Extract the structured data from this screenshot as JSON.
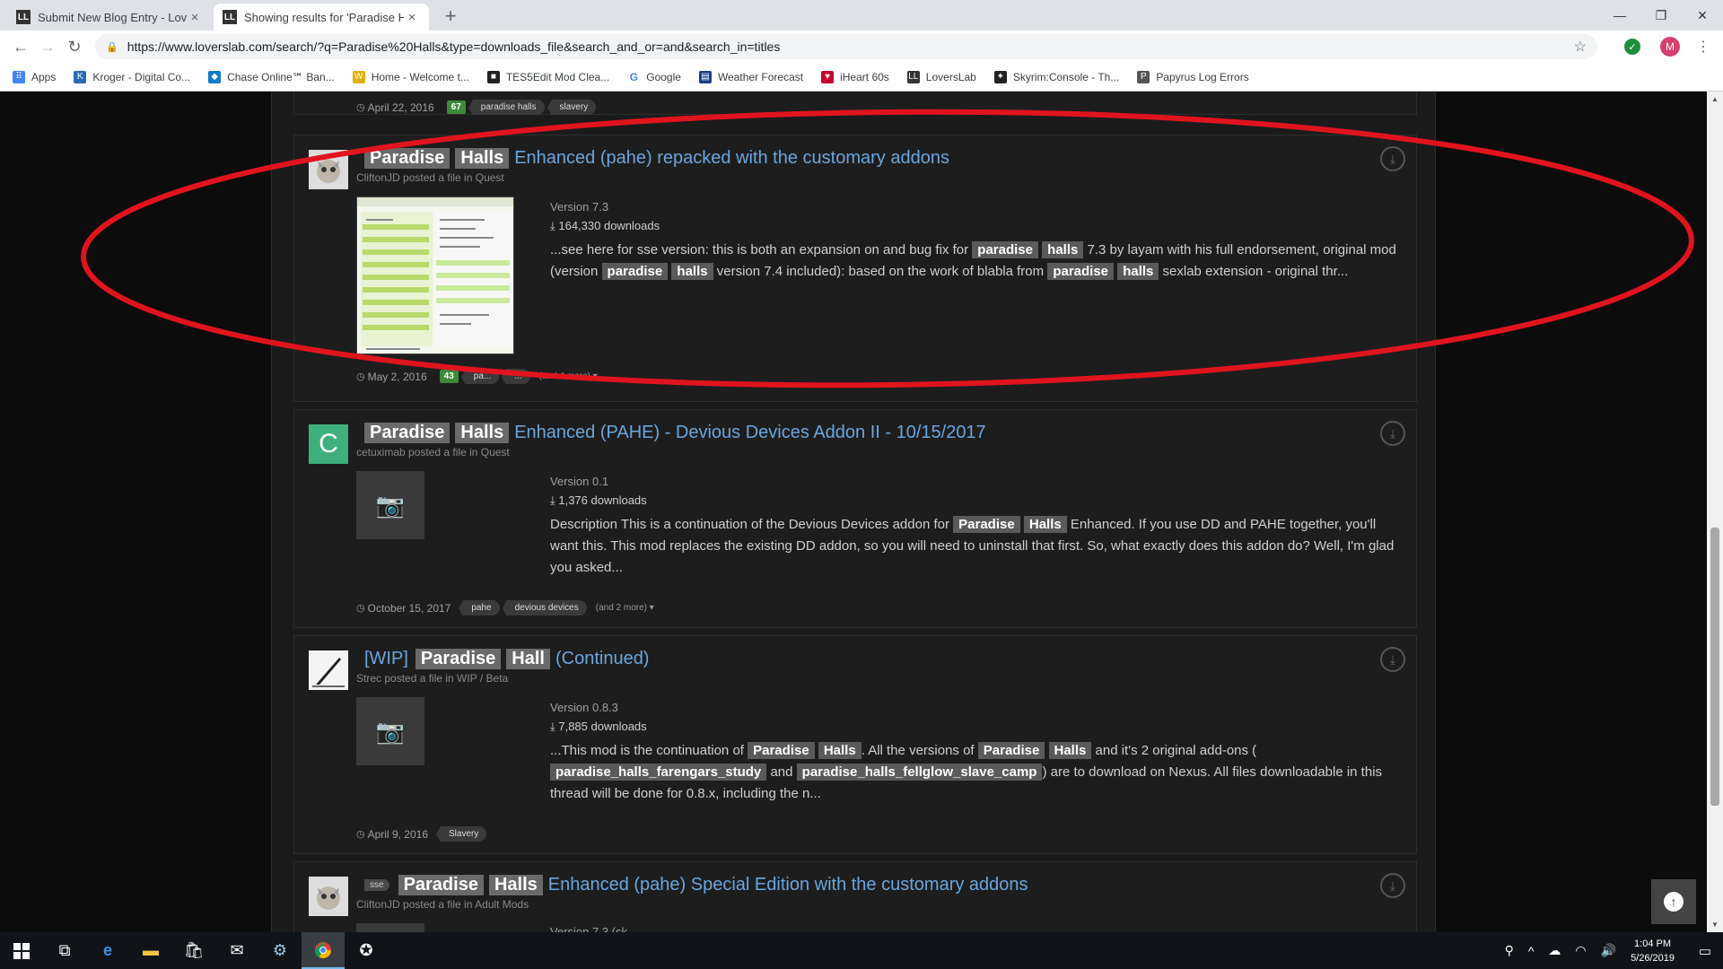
{
  "browser": {
    "tabs": [
      {
        "label": "Submit New Blog Entry - LoversL..."
      },
      {
        "label": "Showing results for 'Paradise Hal..."
      }
    ],
    "url": "https://www.loverslab.com/search/?q=Paradise%20Halls&type=downloads_file&search_and_or=and&search_in=titles",
    "profile_initial": "M",
    "bookmarks": [
      {
        "label": "Apps",
        "color": "#4285f4"
      },
      {
        "label": "Kroger - Digital Co...",
        "color": "#2a6ab8"
      },
      {
        "label": "Chase Online℠ Ban...",
        "color": "#117aca"
      },
      {
        "label": "Home - Welcome t...",
        "color": "#e0b000"
      },
      {
        "label": "TES5Edit Mod Clea...",
        "color": "#222222"
      },
      {
        "label": "Google",
        "color": "#4285f4"
      },
      {
        "label": "Weather Forecast",
        "color": "#1b3f8b"
      },
      {
        "label": "iHeart 60s",
        "color": "#c6002b"
      },
      {
        "label": "LoversLab",
        "color": "#333333"
      },
      {
        "label": "Skyrim:Console - Th...",
        "color": "#222222"
      },
      {
        "label": "Papyrus Log Errors",
        "color": "#555555"
      }
    ]
  },
  "results": {
    "top": {
      "date": "April 22, 2016",
      "count": "67",
      "tags": [
        "paradise halls",
        "slavery"
      ]
    },
    "r1": {
      "title_kw1": "Paradise",
      "title_kw2": "Halls",
      "title_rest": "Enhanced (pahe) repacked with the customary addons",
      "byline": "CliftonJD posted a file in Quest",
      "version": "Version 7.3",
      "downloads": "164,330 downloads",
      "snippet": [
        {
          "t": "...see here for sse version: this is both an expansion on and bug fix for "
        },
        {
          "k": "paradise"
        },
        {
          "t": " "
        },
        {
          "k": "halls"
        },
        {
          "t": " 7.3 by layam with his full endorsement, original mod (version "
        },
        {
          "k": "paradise"
        },
        {
          "t": " "
        },
        {
          "k": "halls"
        },
        {
          "t": " version 7.4 included): based on the work of blabla from "
        },
        {
          "k": "paradise"
        },
        {
          "t": " "
        },
        {
          "k": "halls"
        },
        {
          "t": " sexlab extension - original thr..."
        }
      ],
      "date": "May 2, 2016",
      "count": "43",
      "tags": [
        "pa...",
        "..."
      ],
      "more": "(and 4 more) ▾"
    },
    "r2": {
      "avatar_letter": "C",
      "title_kw1": "Paradise",
      "title_kw2": "Halls",
      "title_rest": "Enhanced (PAHE) - Devious Devices Addon II - 10/15/2017",
      "byline": "cetuximab posted a file in Quest",
      "version": "Version 0.1",
      "downloads": "1,376 downloads",
      "snippet": [
        {
          "t": "Description This is a continuation of the Devious Devices addon for "
        },
        {
          "k": "Paradise"
        },
        {
          "t": " "
        },
        {
          "k": "Halls"
        },
        {
          "t": " Enhanced. If you use DD and PAHE together, you'll want this. This mod replaces the existing DD addon, so you will need to uninstall that first. So, what exactly does this addon do? Well, I'm glad you asked..."
        }
      ],
      "date": "October 15, 2017",
      "tags": [
        "pahe",
        "devious devices"
      ],
      "more": "(and 2 more) ▾"
    },
    "r3": {
      "title_pre": "[WIP]",
      "title_kw1": "Paradise",
      "title_kw2": "Hall",
      "title_rest": "(Continued)",
      "byline": "Strec posted a file in WIP / Beta",
      "version": "Version 0.8.3",
      "downloads": "7,885 downloads",
      "snippet": [
        {
          "t": "...This mod is the continuation of "
        },
        {
          "k": "Paradise"
        },
        {
          "t": " "
        },
        {
          "k": "Halls"
        },
        {
          "t": ". All the versions of "
        },
        {
          "k": "Paradise"
        },
        {
          "t": " "
        },
        {
          "k": "Halls"
        },
        {
          "t": " and it's 2 original add-ons ( "
        },
        {
          "k": "paradise_halls_farengars_study"
        },
        {
          "t": " and "
        },
        {
          "k": "paradise_halls_fellglow_slave_camp"
        },
        {
          "t": ") are to download on Nexus. All files downloadable in this thread will be done for 0.8.x, including the n..."
        }
      ],
      "date": "April 9, 2016",
      "tags": [
        "Slavery"
      ]
    },
    "r4": {
      "badge": "sse",
      "title_kw1": "Paradise",
      "title_kw2": "Halls",
      "title_rest": "Enhanced (pahe) Special Edition with the customary addons",
      "byline": "CliftonJD posted a file in Adult Mods",
      "version": "Version 7.3 (sk..."
    }
  },
  "taskbar": {
    "time": "1:04 PM",
    "date": "5/26/2019"
  },
  "colors": {
    "annotation": "#e0141e",
    "link": "#6aa6de",
    "count_badge": "#3c8a3a"
  }
}
